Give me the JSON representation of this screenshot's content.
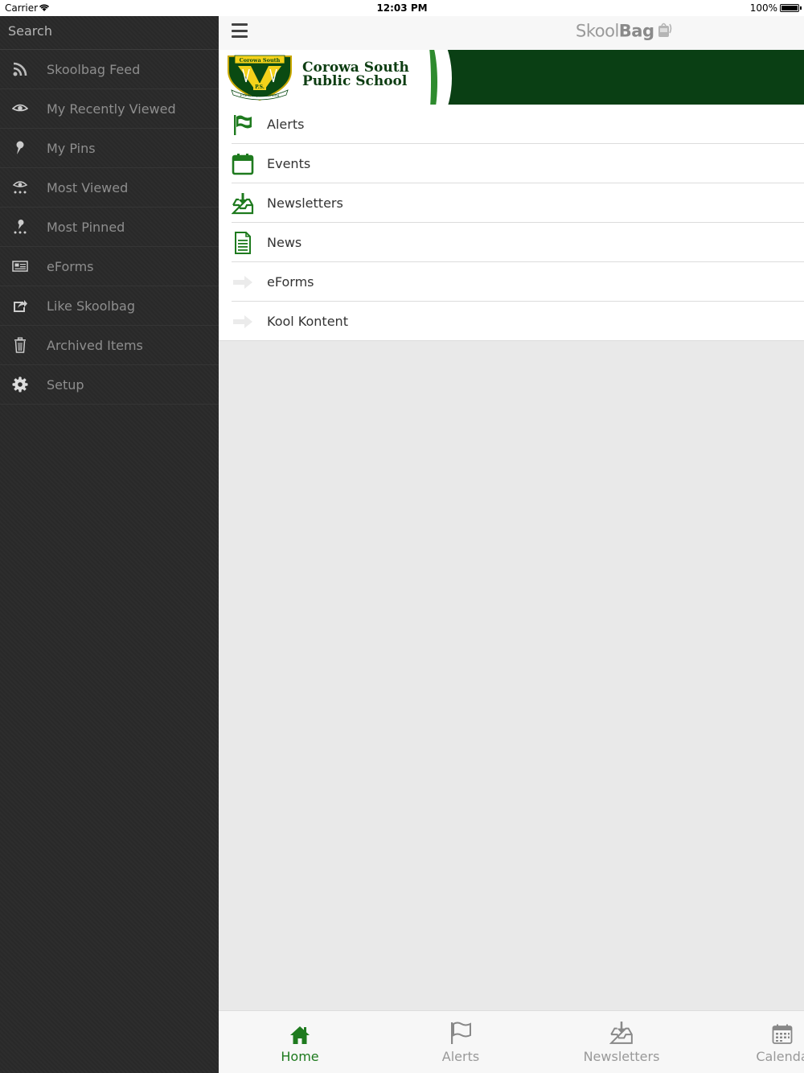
{
  "status_bar": {
    "carrier": "Carrier",
    "time": "12:03 PM",
    "battery": "100%"
  },
  "sidebar": {
    "search_placeholder": "Search",
    "items": [
      {
        "label": "Skoolbag Feed",
        "icon": "rss-icon"
      },
      {
        "label": "My Recently Viewed",
        "icon": "eye-icon"
      },
      {
        "label": "My Pins",
        "icon": "pin-icon"
      },
      {
        "label": "Most Viewed",
        "icon": "eye-dots-icon"
      },
      {
        "label": "Most Pinned",
        "icon": "pin-dots-icon"
      },
      {
        "label": "eForms",
        "icon": "id-card-icon"
      },
      {
        "label": "Like Skoolbag",
        "icon": "share-icon"
      },
      {
        "label": "Archived Items",
        "icon": "trash-icon"
      },
      {
        "label": "Setup",
        "icon": "gear-icon"
      }
    ]
  },
  "header": {
    "brand_light": "Skool",
    "brand_bold": "Bag"
  },
  "banner": {
    "school_line1": "Corowa South",
    "school_line2": "Public School",
    "crest_top": "Corowa South",
    "crest_mid": "P.S.",
    "crest_motto": "Friendship & Learning"
  },
  "menu": {
    "items": [
      {
        "label": "Alerts",
        "icon": "flag-icon"
      },
      {
        "label": "Events",
        "icon": "calendar-icon"
      },
      {
        "label": "Newsletters",
        "icon": "inbox-download-icon"
      },
      {
        "label": "News",
        "icon": "document-icon"
      },
      {
        "label": "eForms",
        "icon": "arrow-right-icon"
      },
      {
        "label": "Kool Kontent",
        "icon": "arrow-right-icon"
      }
    ]
  },
  "tabs": [
    {
      "label": "Home",
      "icon": "home-icon",
      "active": true
    },
    {
      "label": "Alerts",
      "icon": "flag-icon",
      "active": false
    },
    {
      "label": "Newsletters",
      "icon": "inbox-download-icon",
      "active": false
    },
    {
      "label": "Calenda",
      "icon": "calendar-grid-icon",
      "active": false
    }
  ],
  "colors": {
    "accent_green": "#1e7a1e",
    "banner_dark_green": "#0a3f14",
    "sidebar_bg": "#2a2a2a"
  }
}
